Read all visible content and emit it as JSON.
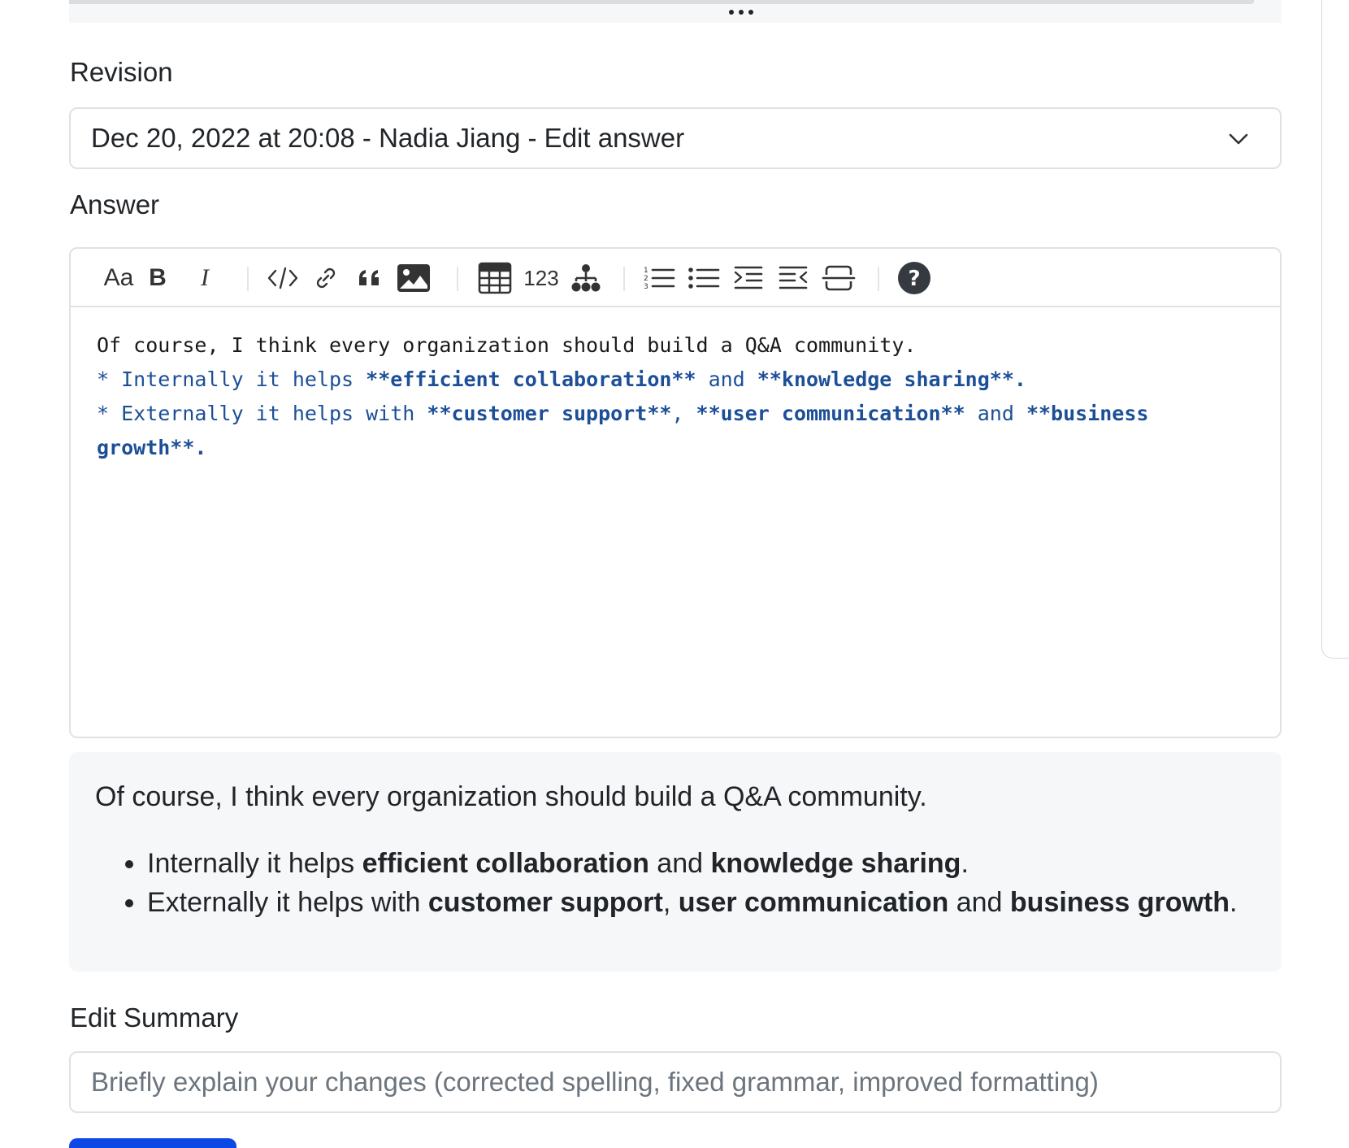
{
  "revision": {
    "label": "Revision",
    "selected": "Dec 20, 2022 at 20:08 - Nadia Jiang - Edit answer"
  },
  "answer": {
    "label": "Answer",
    "toolbar": {
      "heading": "Aa",
      "bold": "B",
      "italic": "I",
      "number": "123"
    },
    "source": {
      "line1": "Of course, I think every organization should build a Q&A community.",
      "l2_a": "* Internally it helps ",
      "l2_b": "**efficient collaboration**",
      "l2_c": " and ",
      "l2_d": "**knowledge sharing**",
      "l2_e": ".",
      "l3_a": "* Externally it helps with ",
      "l3_b": "**customer support**",
      "l3_c": ", ",
      "l3_d": "**user communication**",
      "l3_e": " and ",
      "l3_f": "**business growth**",
      "l3_g": "."
    }
  },
  "preview": {
    "paragraph": "Of course, I think every organization should build a Q&A community.",
    "item1_a": "Internally it helps ",
    "item1_b": "efficient collaboration",
    "item1_c": " and ",
    "item1_d": "knowledge sharing",
    "item1_e": ".",
    "item2_a": "Externally it helps with ",
    "item2_b": "customer support",
    "item2_c": ", ",
    "item2_d": "user communication",
    "item2_e": " and ",
    "item2_f": "business growth",
    "item2_g": "."
  },
  "summary": {
    "label": "Edit Summary",
    "placeholder": "Briefly explain your changes (corrected spelling, fixed grammar, improved formatting)",
    "value": ""
  },
  "colors": {
    "accent": "#0d47e6",
    "markdown_blue": "#1c4f97"
  }
}
